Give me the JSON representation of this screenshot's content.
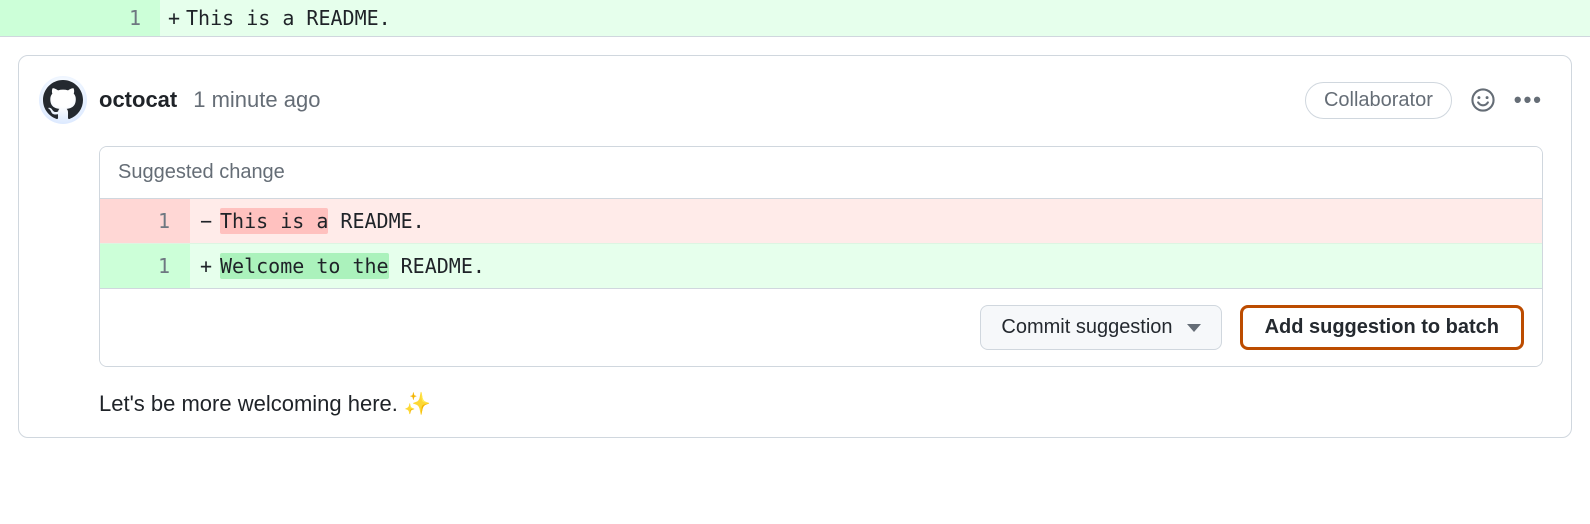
{
  "top_diff": {
    "line_number": "1",
    "marker": "+",
    "code": "This is a README."
  },
  "comment": {
    "username": "octocat",
    "timestamp": "1 minute ago",
    "badge": "Collaborator",
    "body": "Let's be more welcoming here.",
    "emoji": "✨"
  },
  "suggestion": {
    "title": "Suggested change",
    "del": {
      "line_number": "1",
      "marker": "−",
      "highlight": "This is a",
      "rest": " README."
    },
    "add": {
      "line_number": "1",
      "marker": "+",
      "highlight": "Welcome to the",
      "rest": " README."
    },
    "commit_label": "Commit suggestion",
    "batch_label": "Add suggestion to batch"
  }
}
